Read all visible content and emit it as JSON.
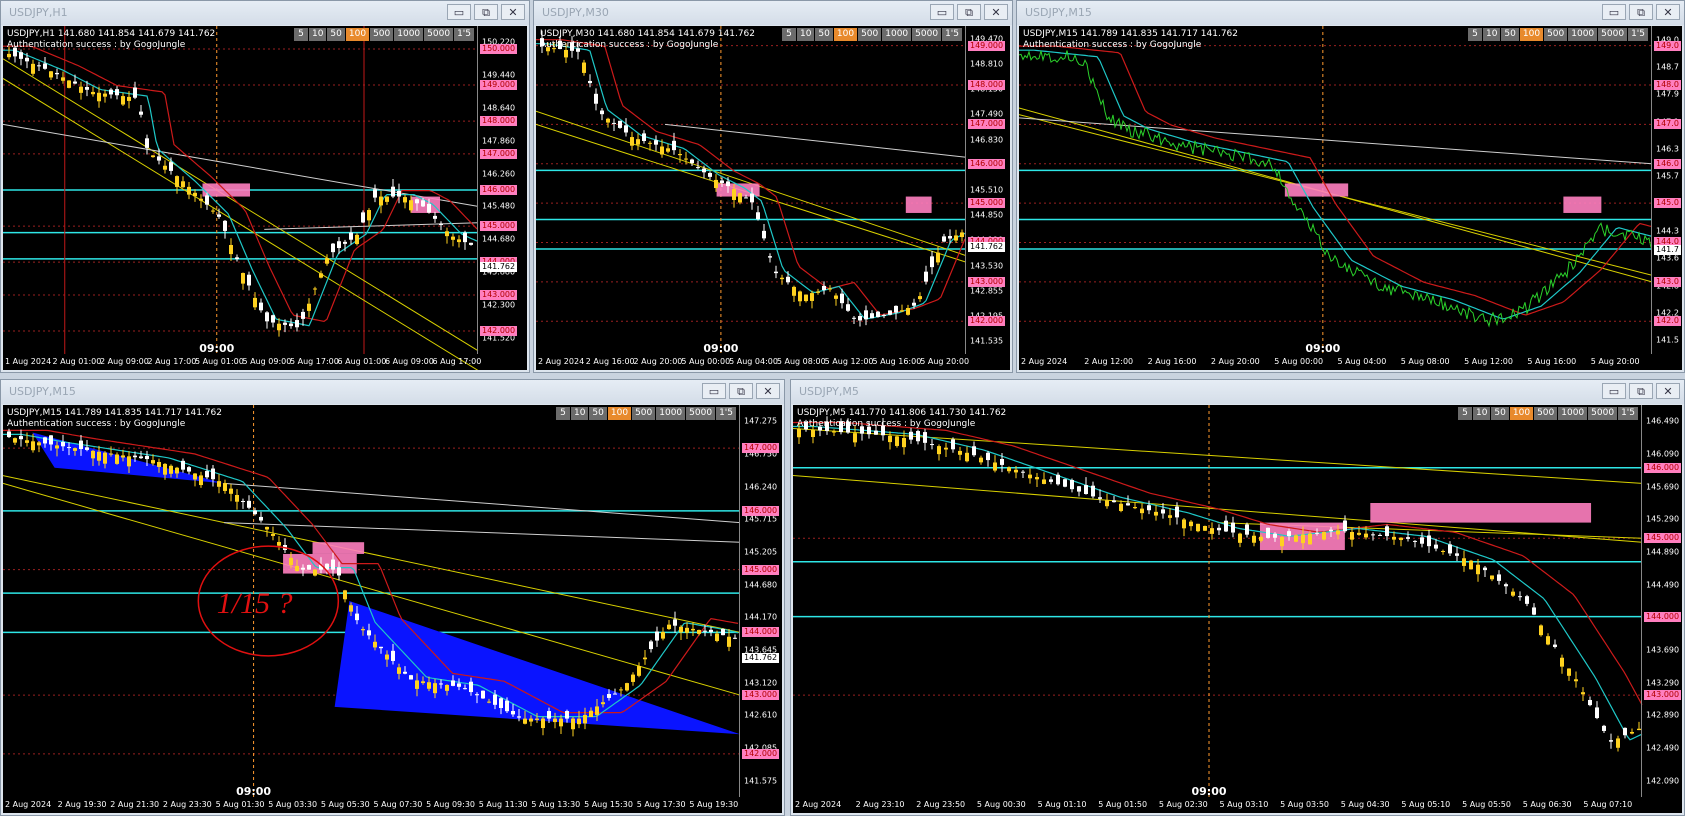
{
  "windows": [
    {
      "id": "h1",
      "title": "USDJPY,H1",
      "symbol_line": "USDJPY,H1  141.680 141.854 141.679 141.762",
      "auth": "Authentication success : by GogoJungle",
      "periods": [
        "5",
        "10",
        "50",
        "100",
        "500",
        "1000",
        "5000",
        "1'5"
      ],
      "active_period": "100",
      "scale": [
        "150.220",
        "149.440",
        "148.640",
        "147.860",
        "146.260",
        "145.480",
        "144.680",
        "143.880",
        "142.300",
        "141.520"
      ],
      "price_labels": [
        "150.000",
        "149.000",
        "148.000",
        "147.000",
        "146.000",
        "145.000",
        "144.000",
        "143.000",
        "142.000"
      ],
      "current_price": "141.762",
      "time_labels": [
        "1 Aug 2024",
        "2 Aug 01:00",
        "2 Aug 09:00",
        "2 Aug 17:00",
        "5 Aug 01:00",
        "5 Aug 09:00",
        "5 Aug 17:00",
        "6 Aug 01:00",
        "6 Aug 09:00",
        "6 Aug 17:00"
      ],
      "vline_label": "09:00"
    },
    {
      "id": "m30",
      "title": "USDJPY,M30",
      "symbol_line": "USDJPY,M30  141.680 141.854 141.679 141.762",
      "auth": "Authentication success : by GogoJungle",
      "periods": [
        "5",
        "10",
        "50",
        "100",
        "500",
        "1000",
        "5000",
        "1'5"
      ],
      "active_period": "100",
      "scale": [
        "149.470",
        "148.810",
        "148.150",
        "147.490",
        "146.830",
        "146.170",
        "145.510",
        "144.850",
        "144.190",
        "143.530",
        "142.855",
        "142.195",
        "141.535"
      ],
      "price_labels": [
        "149.000",
        "148.000",
        "147.000",
        "146.000",
        "145.000",
        "144.000",
        "143.000",
        "142.000"
      ],
      "current_price": "141.762",
      "time_labels": [
        "2 Aug 2024",
        "2 Aug 16:00",
        "2 Aug 20:00",
        "5 Aug 00:00",
        "5 Aug 04:00",
        "5 Aug 08:00",
        "5 Aug 12:00",
        "5 Aug 16:00",
        "5 Aug 20:00"
      ],
      "vline_label": "09:00"
    },
    {
      "id": "m15a",
      "title": "USDJPY,M15",
      "symbol_line": "USDJPY,M15  141.789 141.835 141.717 141.762",
      "auth": "Authentication success : by GogoJungle",
      "periods": [
        "5",
        "10",
        "50",
        "100",
        "500",
        "1000",
        "5000",
        "1'5"
      ],
      "active_period": "100",
      "scale": [
        "149.0",
        "148.7",
        "147.9",
        "147.1",
        "146.3",
        "145.7",
        "144.9",
        "144.3",
        "143.6",
        "142.8",
        "142.2",
        "141.5"
      ],
      "price_labels": [
        "149.0",
        "148.0",
        "147.0",
        "146.0",
        "145.0",
        "144.0",
        "143.0",
        "142.0"
      ],
      "current_price": "141.7",
      "time_labels": [
        "2 Aug 2024",
        "2 Aug 12:00",
        "2 Aug 16:00",
        "2 Aug 20:00",
        "5 Aug 00:00",
        "5 Aug 04:00",
        "5 Aug 08:00",
        "5 Aug 12:00",
        "5 Aug 16:00",
        "5 Aug 20:00"
      ],
      "vline_label": "09:00"
    },
    {
      "id": "m15b",
      "title": "USDJPY,M15",
      "symbol_line": "USDJPY,M15  141.789 141.835 141.717 141.762",
      "auth": "Authentication success : by GogoJungle",
      "periods": [
        "5",
        "10",
        "50",
        "100",
        "500",
        "1000",
        "5000",
        "1'5"
      ],
      "active_period": "100",
      "scale": [
        "147.275",
        "146.750",
        "146.240",
        "145.715",
        "145.205",
        "144.680",
        "144.170",
        "143.645",
        "143.120",
        "142.610",
        "142.085",
        "141.575"
      ],
      "price_labels": [
        "147.000",
        "146.000",
        "145.000",
        "144.000",
        "143.000",
        "142.000"
      ],
      "current_price": "141.762",
      "time_labels": [
        "2 Aug 2024",
        "2 Aug 19:30",
        "2 Aug 21:30",
        "2 Aug 23:30",
        "5 Aug 01:30",
        "5 Aug 03:30",
        "5 Aug 05:30",
        "5 Aug 07:30",
        "5 Aug 09:30",
        "5 Aug 11:30",
        "5 Aug 13:30",
        "5 Aug 15:30",
        "5 Aug 17:30",
        "5 Aug 19:30"
      ],
      "vline_label": "09:00",
      "annotation": "1/15 ?"
    },
    {
      "id": "m5",
      "title": "USDJPY,M5",
      "symbol_line": "USDJPY,M5  141.770 141.806 141.730 141.762",
      "auth": "Authentication success : by GogoJungle",
      "periods": [
        "5",
        "10",
        "50",
        "100",
        "500",
        "1000",
        "5000",
        "1'5"
      ],
      "active_period": "100",
      "scale": [
        "146.490",
        "146.090",
        "145.690",
        "145.290",
        "144.890",
        "144.490",
        "144.090",
        "143.690",
        "143.290",
        "142.890",
        "142.490",
        "142.090"
      ],
      "price_labels": [
        "146.000",
        "145.000",
        "144.000",
        "143.000"
      ],
      "current_price": "",
      "time_labels": [
        "2 Aug 2024",
        "2 Aug 23:10",
        "2 Aug 23:50",
        "5 Aug 00:30",
        "5 Aug 01:10",
        "5 Aug 01:50",
        "5 Aug 02:30",
        "5 Aug 03:10",
        "5 Aug 03:50",
        "5 Aug 04:30",
        "5 Aug 05:10",
        "5 Aug 05:50",
        "5 Aug 06:30",
        "5 Aug 07:10"
      ],
      "vline_label": "09:00"
    }
  ],
  "window_buttons": {
    "minimize": "▭",
    "restore": "⧉",
    "close": "✕"
  },
  "colors": {
    "bull": "#ffd21f",
    "bear": "#ffffff",
    "cyan": "#2ee6e6",
    "zone": "#ff80c0",
    "trend": "#d8d000",
    "ma_red": "#cc1a1a",
    "ma_cyan": "#1fc8c8",
    "triangle": "#0a14ff",
    "vline": "#ff9a2e"
  }
}
